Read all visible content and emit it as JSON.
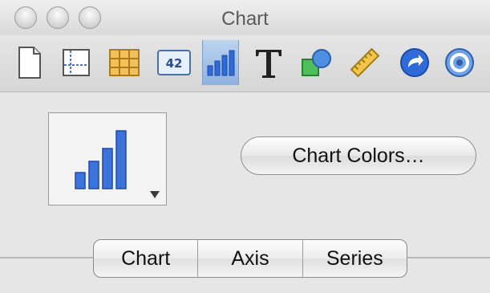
{
  "window": {
    "title": "Chart"
  },
  "toolbar": {
    "items": [
      {
        "name": "document-inspector",
        "icon": "page-icon"
      },
      {
        "name": "layout-inspector",
        "icon": "layout-icon"
      },
      {
        "name": "table-inspector",
        "icon": "table-icon"
      },
      {
        "name": "cell-format-inspector",
        "icon": "number-format-icon",
        "label": "42"
      },
      {
        "name": "chart-inspector",
        "icon": "bar-chart-icon",
        "selected": true
      },
      {
        "name": "text-inspector",
        "icon": "text-icon"
      },
      {
        "name": "graphic-inspector",
        "icon": "shape-icon"
      },
      {
        "name": "metrics-inspector",
        "icon": "ruler-icon"
      },
      {
        "name": "hyperlink-inspector",
        "icon": "link-arrow-icon"
      },
      {
        "name": "quicktime-inspector",
        "icon": "spiral-icon"
      }
    ]
  },
  "chart": {
    "type_icon": "bar-chart-icon",
    "colors_button_label": "Chart Colors…"
  },
  "tabs": [
    {
      "label": "Chart"
    },
    {
      "label": "Axis"
    },
    {
      "label": "Series"
    }
  ],
  "colors": {
    "accent_blue": "#2f6bd8",
    "selected_tool_bg": "#a9c4ea"
  }
}
